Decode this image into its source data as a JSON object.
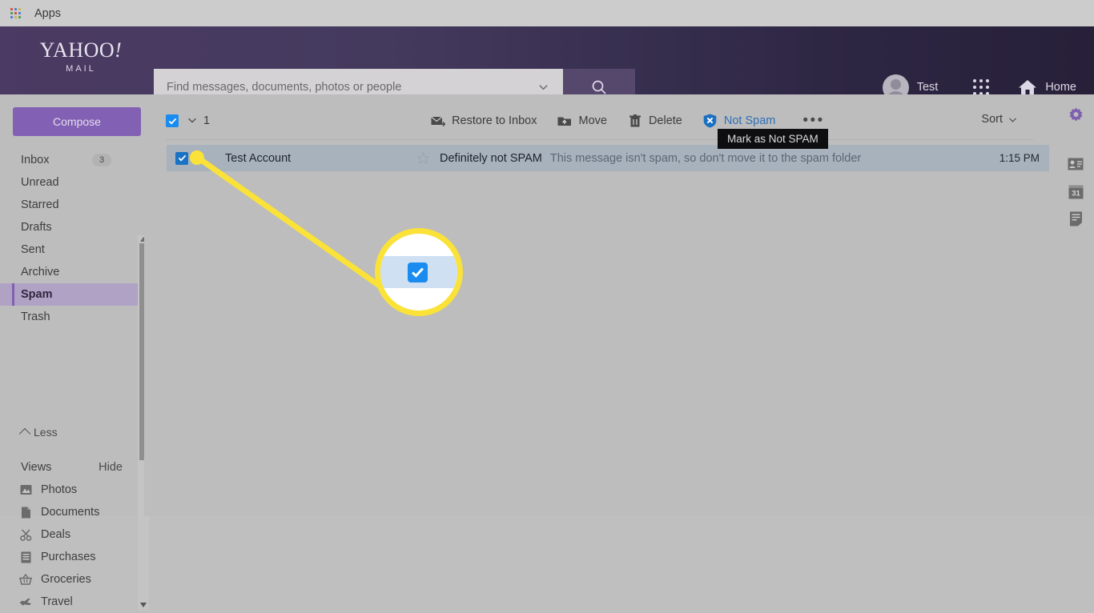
{
  "browser_bar": {
    "apps_label": "Apps",
    "apps_icon": "apps-grid-icon"
  },
  "header": {
    "logo_word": "YAHOO",
    "logo_exclaim": "!",
    "logo_sub": "MAIL",
    "search": {
      "value": "",
      "placeholder": "Find messages, documents, photos or people",
      "chevron_icon": "chevron-down-icon",
      "search_icon": "search-icon"
    },
    "account_name": "Test",
    "avatar_icon": "avatar-icon",
    "apps_dots_icon": "apps-dots-icon",
    "home_icon": "home-icon",
    "home_label": "Home"
  },
  "sidebar": {
    "compose_label": "Compose",
    "folders": [
      {
        "label": "Inbox",
        "badge": "3",
        "active": false
      },
      {
        "label": "Unread",
        "badge": "",
        "active": false
      },
      {
        "label": "Starred",
        "badge": "",
        "active": false
      },
      {
        "label": "Drafts",
        "badge": "",
        "active": false
      },
      {
        "label": "Sent",
        "badge": "",
        "active": false
      },
      {
        "label": "Archive",
        "badge": "",
        "active": false
      },
      {
        "label": "Spam",
        "badge": "",
        "active": true
      },
      {
        "label": "Trash",
        "badge": "",
        "active": false
      }
    ],
    "less_label": "Less",
    "less_icon": "chevron-up-icon",
    "views_title": "Views",
    "views_hide_label": "Hide",
    "views": [
      {
        "label": "Photos",
        "icon": "photo-icon"
      },
      {
        "label": "Documents",
        "icon": "document-icon"
      },
      {
        "label": "Deals",
        "icon": "scissors-icon"
      },
      {
        "label": "Purchases",
        "icon": "receipt-icon"
      },
      {
        "label": "Groceries",
        "icon": "basket-icon"
      },
      {
        "label": "Travel",
        "icon": "airplane-icon"
      }
    ],
    "scrollbar": {
      "up_icon": "scroll-up-arrow-icon",
      "down_icon": "scroll-down-arrow-icon"
    }
  },
  "toolbar": {
    "select_all_checked": true,
    "select_all_icon": "checkbox-checked-icon",
    "dropdown_icon": "chevron-down-icon",
    "selected_count": "1",
    "actions": [
      {
        "label": "Restore to Inbox",
        "icon": "restore-to-inbox-icon",
        "link": false
      },
      {
        "label": "Move",
        "icon": "move-folder-icon",
        "link": false
      },
      {
        "label": "Delete",
        "icon": "trash-icon",
        "link": false
      },
      {
        "label": "Not Spam",
        "icon": "shield-icon",
        "link": true
      }
    ],
    "more_icon": "more-ellipsis-icon",
    "sort_label": "Sort",
    "sort_icon": "chevron-down-icon"
  },
  "message_list": {
    "rows": [
      {
        "checked": true,
        "checkbox_icon": "checkbox-checked-icon",
        "star_icon": "star-icon",
        "sender": "Test Account",
        "subject": "Definitely not SPAM",
        "snippet": "This message isn't spam, so don't move it to the spam folder",
        "time": "1:15 PM"
      }
    ]
  },
  "right_rail": {
    "items": [
      {
        "icon": "gear-icon",
        "color": "#7f5fb0"
      },
      {
        "icon": "contacts-card-icon",
        "color": "#6b6b6b"
      },
      {
        "icon": "calendar-icon",
        "color": "#6b6b6b",
        "day": "31"
      },
      {
        "icon": "notepad-icon",
        "color": "#6b6b6b"
      }
    ]
  },
  "annotations": {
    "tooltip_text": "Mark as Not SPAM",
    "highlight_color": "#fae238",
    "magnifier": {
      "checkbox_icon": "checkbox-checked-icon",
      "checkbox_color": "#1a8cf0"
    }
  }
}
